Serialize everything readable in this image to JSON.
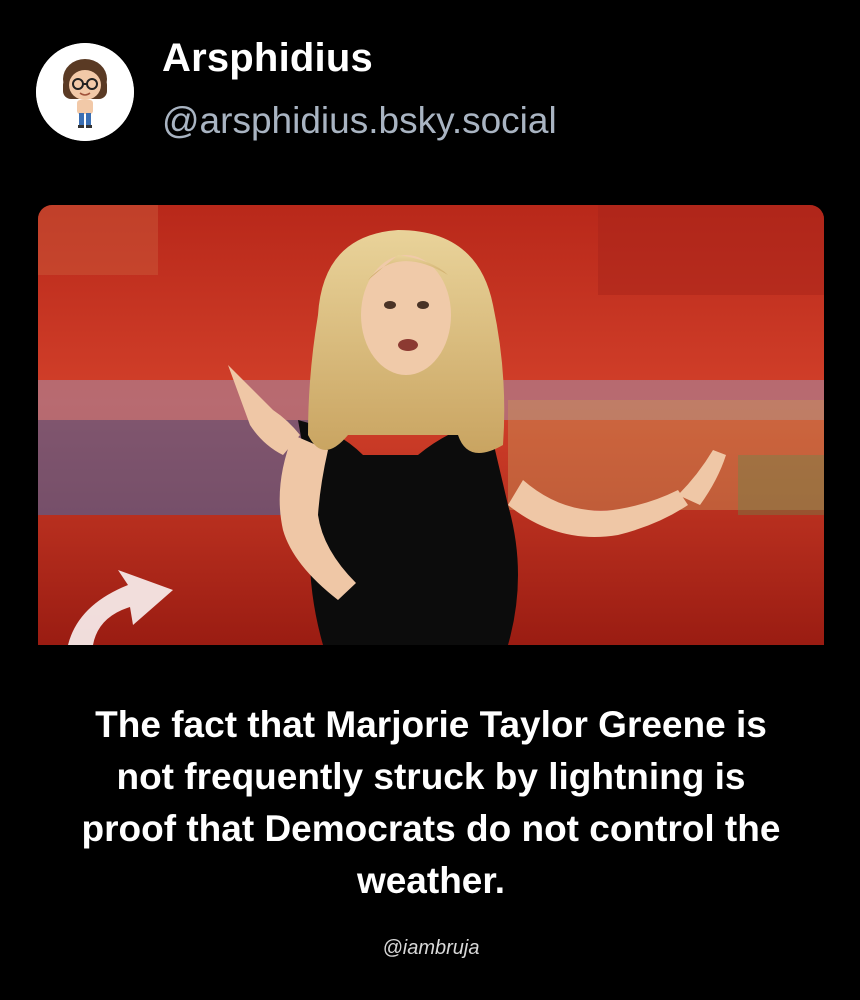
{
  "post": {
    "author": {
      "display_name": "Arsphidius",
      "handle": "@arsphidius.bsky.social",
      "avatar_icon": "cartoon-avatar-icon"
    },
    "embed": {
      "photo_icon": "speaker-photo",
      "caption": "The fact that Marjorie Taylor Greene is not frequently struck by lightning is proof that Democrats do not control the weather.",
      "credit": "@iambruja"
    }
  },
  "colors": {
    "background": "#000000",
    "display_name": "#ffffff",
    "handle": "#a9b4c2",
    "photo_backdrop": "#c8321f"
  }
}
